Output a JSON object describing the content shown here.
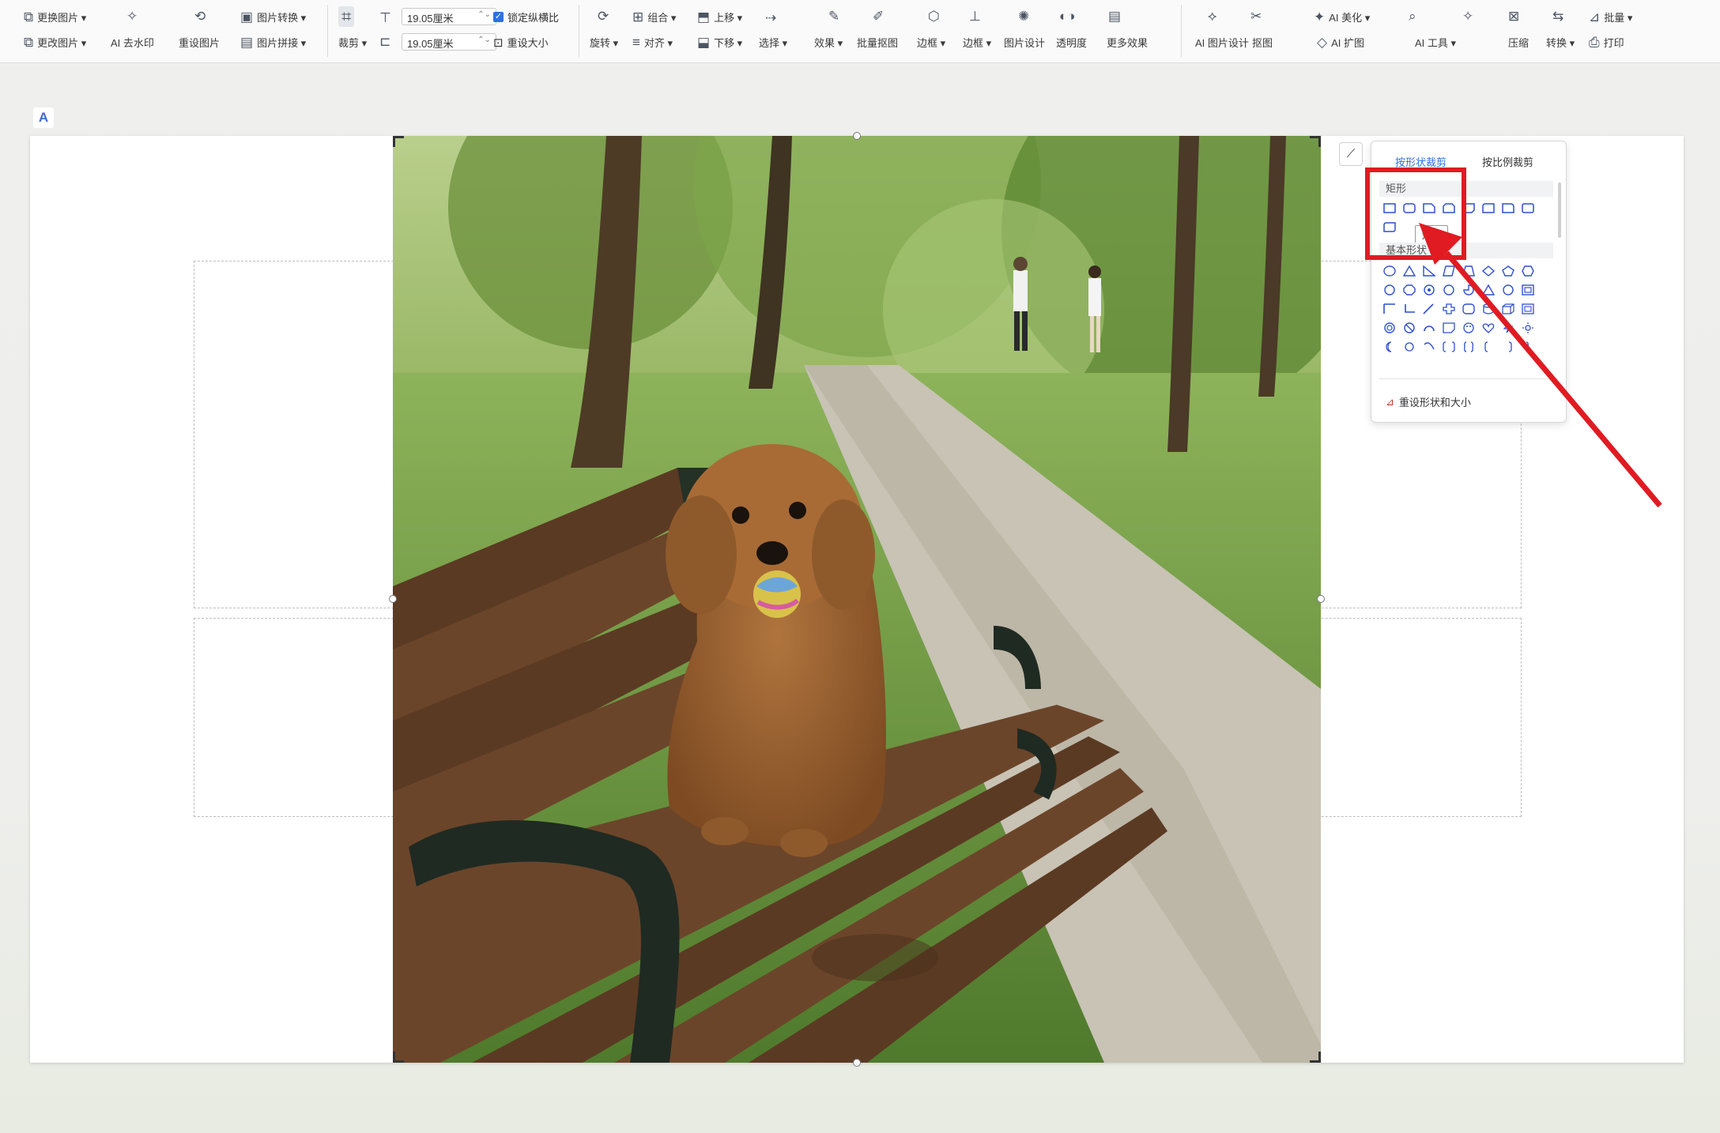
{
  "toolbar": {
    "group1": [
      {
        "label": "更换图片 ▾",
        "icon": "image-replace-icon"
      },
      {
        "label": "AI 去水印",
        "icon": "sparkle-icon"
      },
      {
        "label": "图片转换 ▾",
        "icon": "convert-icon"
      },
      {
        "label": "更改图片 ▾",
        "icon": "image-swap-icon"
      },
      {
        "label": "重设图片",
        "icon": "reset-icon"
      },
      {
        "label": "图片拼接 ▾",
        "icon": "collage-icon"
      }
    ],
    "crop": {
      "label": "裁剪 ▾"
    },
    "dims": [
      {
        "value": "19.05厘米",
        "icon": "height-icon"
      },
      {
        "value": "19.05厘米",
        "icon": "width-icon"
      }
    ],
    "lock_ratio": "锁定纵横比",
    "reset_size": "重设大小",
    "group2": [
      {
        "label": "旋转 ▾"
      },
      {
        "label": "组合 ▾"
      },
      {
        "label": "上移 ▾"
      },
      {
        "label": "对齐 ▾"
      },
      {
        "label": "下移 ▾"
      },
      {
        "label": "选择 ▾"
      }
    ],
    "group3": [
      {
        "label": "效果 ▾"
      },
      {
        "label": "批量抠图"
      },
      {
        "label": "边框 ▾"
      },
      {
        "label": "边框 ▾"
      },
      {
        "label": "图片设计"
      },
      {
        "label": "透明度"
      },
      {
        "label": "更多效果"
      }
    ],
    "group4": [
      {
        "label": "AI 图片设计"
      },
      {
        "label": "抠图"
      },
      {
        "label": "AI 美化 ▾"
      },
      {
        "label": "AI 扩图"
      },
      {
        "label": "AI 工具 ▾"
      },
      {
        "label": "压缩"
      },
      {
        "label": "转换 ▾"
      },
      {
        "label": "打印"
      },
      {
        "label": "批量 ▾"
      }
    ]
  },
  "panel": {
    "tabs": [
      "按形状裁剪",
      "按比例裁剪"
    ],
    "section_rect": "矩形",
    "section_basic": "基本形状",
    "tooltip": "矩形",
    "footer": "重设形状和大小"
  }
}
